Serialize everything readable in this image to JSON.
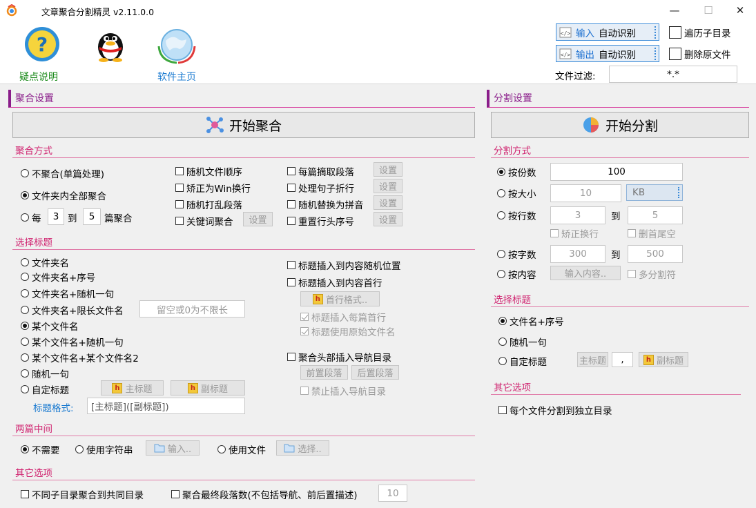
{
  "window": {
    "title": "文章聚合分割精灵 v2.11.0.0",
    "minimize": "—",
    "maximize": "☐",
    "close": "✕"
  },
  "top": {
    "help_label": "疑点说明",
    "home_label": "软件主页",
    "input_btn": {
      "prefix": "输入",
      "label": "自动识别"
    },
    "output_btn": {
      "prefix": "输出",
      "label": "自动识别"
    },
    "traverse_label": "遍历子目录",
    "delete_label": "删除原文件",
    "filter_label": "文件过滤:",
    "filter_value": "*.*"
  },
  "merge": {
    "section_title": "聚合设置",
    "start_button": "开始聚合",
    "mode": {
      "title": "聚合方式",
      "no_merge": "不聚合(单篇处理)",
      "all_merge": "文件夹内全部聚合",
      "each_prefix": "每",
      "each_from": "3",
      "each_to_label": "到",
      "each_to": "5",
      "each_suffix": "篇聚合",
      "random_order": "随机文件顺序",
      "fix_win": "矫正为Win换行",
      "shuffle_para": "随机打乱段落",
      "keyword_merge": "关键词聚合",
      "extract_para": "每篇摘取段落",
      "sentence_wrap": "处理句子折行",
      "pinyin": "随机替换为拼音",
      "renumber": "重置行头序号",
      "settings": "设置"
    },
    "title_select": {
      "title": "选择标题",
      "options": [
        "文件夹名",
        "文件夹名+序号",
        "文件夹名+随机一句",
        "文件夹名+限长文件名",
        "某个文件名",
        "某个文件名+随机一句",
        "某个文件名+某个文件名2",
        "随机一句",
        "自定标题"
      ],
      "limit_placeholder": "留空或0为不限长",
      "main_title_btn": "主标题",
      "sub_title_btn": "副标题",
      "format_label": "标题格式:",
      "format_value": "[主标题]([副标题])",
      "insert_random": "标题插入到内容随机位置",
      "insert_first": "标题插入到内容首行",
      "first_line_format": "首行格式..",
      "each_first": "标题插入每篇首行",
      "use_original": "标题使用原始文件名",
      "nav_header": "聚合头部插入导航目录",
      "pre_para": "前置段落",
      "post_para": "后置段落",
      "forbid_nav": "禁止插入导航目录"
    },
    "between": {
      "title": "两篇中间",
      "none": "不需要",
      "use_string": "使用字符串",
      "input_btn": "输入..",
      "use_file": "使用文件",
      "select_btn": "选择.."
    },
    "other": {
      "title": "其它选项",
      "diff_dir": "不同子目录聚合到共同目录",
      "final_count": "聚合最终段落数(不包括导航、前后置描述)",
      "final_value": "10"
    }
  },
  "split": {
    "section_title": "分割设置",
    "start_button": "开始分割",
    "mode": {
      "title": "分割方式",
      "by_count": "按份数",
      "count_value": "100",
      "by_size": "按大小",
      "size_value": "10",
      "size_unit": "KB",
      "by_lines": "按行数",
      "lines_from": "3",
      "lines_to_label": "到",
      "lines_to": "5",
      "fix_wrap": "矫正换行",
      "trim_blank": "删首尾空",
      "by_chars": "按字数",
      "chars_from": "300",
      "chars_to_label": "到",
      "chars_to": "500",
      "by_content": "按内容",
      "content_btn": "输入内容..",
      "multi_sep": "多分割符"
    },
    "title_select": {
      "title": "选择标题",
      "filename_seq": "文件名+序号",
      "random_sentence": "随机一句",
      "custom": "自定标题",
      "main_title_btn": "主标题",
      "separator": ",",
      "sub_title_btn": "副标题"
    },
    "other": {
      "title": "其它选项",
      "each_dir": "每个文件分割到独立目录"
    }
  }
}
